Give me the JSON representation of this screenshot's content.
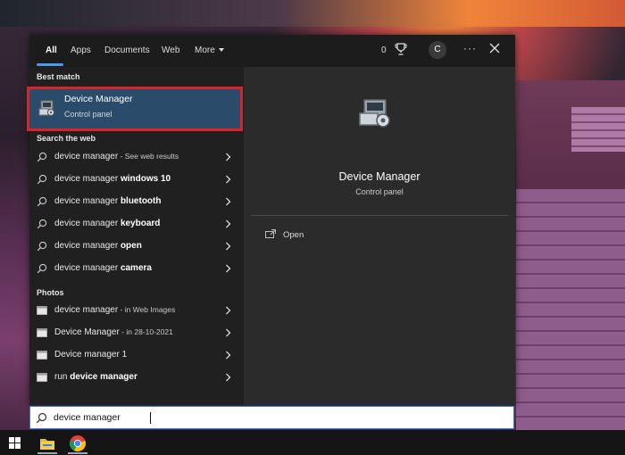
{
  "tabs": [
    {
      "label": "All",
      "active": true
    },
    {
      "label": "Apps"
    },
    {
      "label": "Documents"
    },
    {
      "label": "Web"
    },
    {
      "label": "More"
    }
  ],
  "header": {
    "points": "0",
    "avatar_letter": "C"
  },
  "left": {
    "best_match_heading": "Best match",
    "best_match": {
      "title": "Device Manager",
      "subtitle": "Control panel"
    },
    "web_heading": "Search the web",
    "web_results": [
      {
        "prefix": "device manager",
        "bold": "",
        "suffix": " - See web results"
      },
      {
        "prefix": "device manager ",
        "bold": "windows 10",
        "suffix": ""
      },
      {
        "prefix": "device manager ",
        "bold": "bluetooth",
        "suffix": ""
      },
      {
        "prefix": "device manager ",
        "bold": "keyboard",
        "suffix": ""
      },
      {
        "prefix": "device manager ",
        "bold": "open",
        "suffix": ""
      },
      {
        "prefix": "device manager ",
        "bold": "camera",
        "suffix": ""
      }
    ],
    "photos_heading": "Photos",
    "photos": [
      {
        "prefix": "device manager",
        "bold": "",
        "suffix": " - in Web Images"
      },
      {
        "prefix": "Device Manager",
        "bold": "",
        "suffix": " - in 28-10-2021"
      },
      {
        "prefix": "Device manager 1",
        "bold": "",
        "suffix": ""
      },
      {
        "prefix": "run ",
        "bold": "device manager",
        "suffix": ""
      }
    ]
  },
  "preview": {
    "title": "Device Manager",
    "subtitle": "Control panel",
    "action_open": "Open"
  },
  "search": {
    "value": "device manager"
  },
  "colors": {
    "accent": "#4c9bea",
    "highlight_border": "#d3262a",
    "selected_bg": "#2b4b6b"
  }
}
